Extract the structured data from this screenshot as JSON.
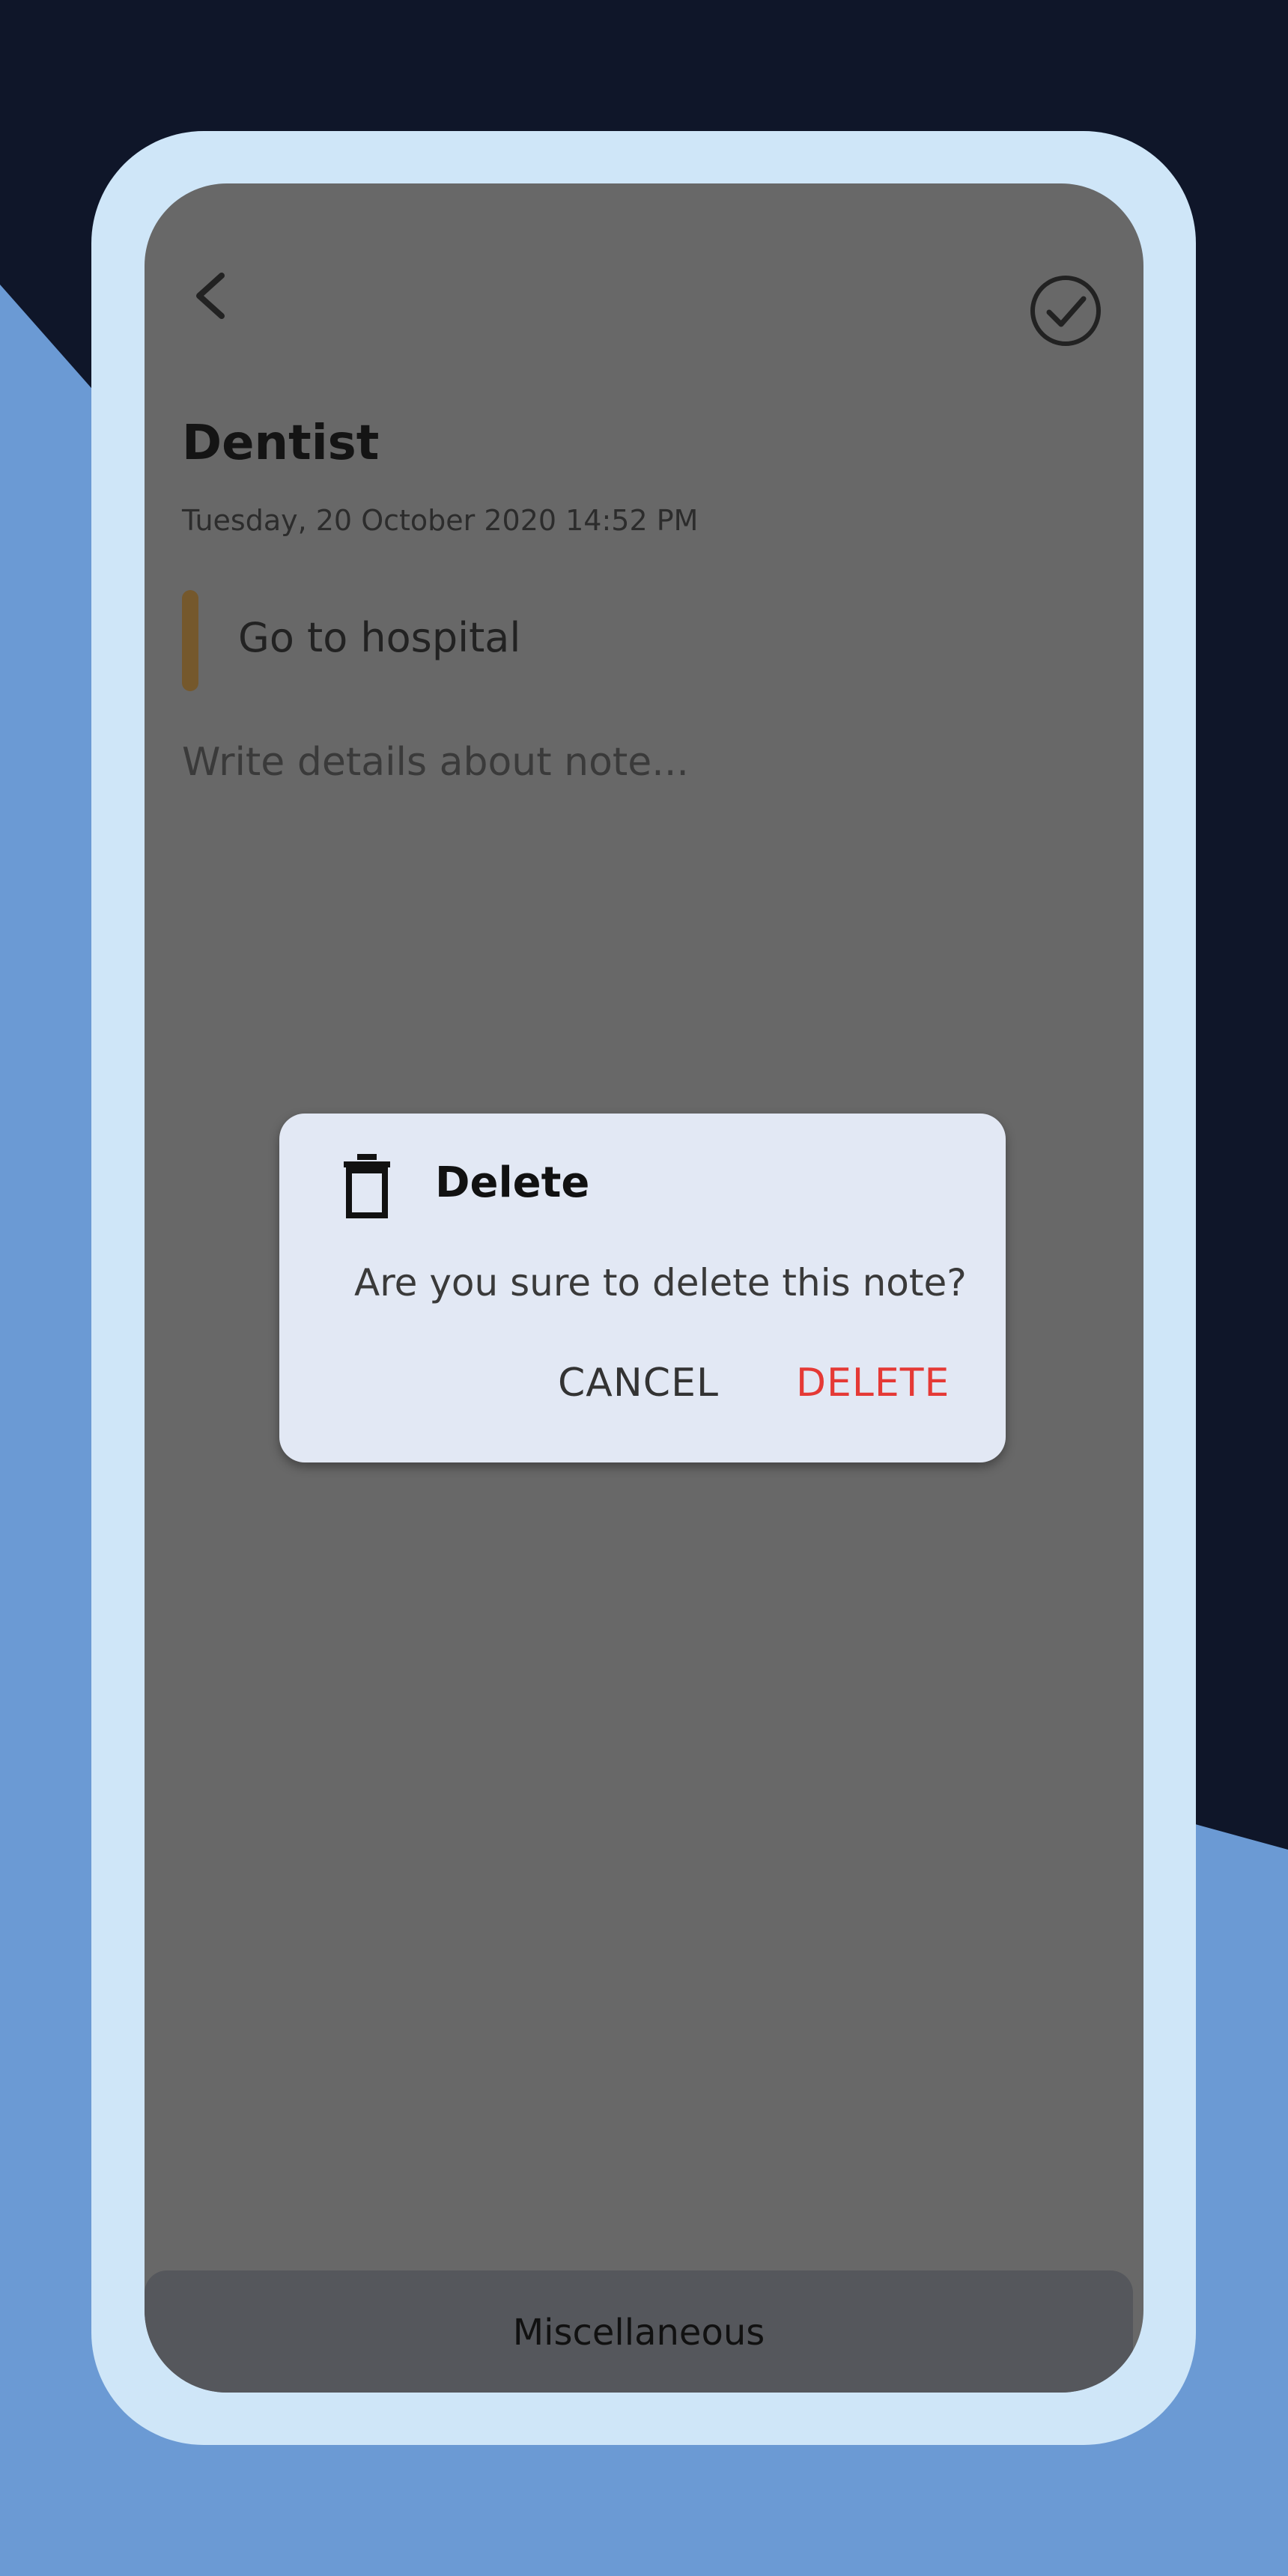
{
  "note": {
    "title": "Dentist",
    "date": "Tuesday, 20 October 2020 14:52 PM",
    "subtitle": "Go to hospital",
    "details_placeholder": "Write details about note..."
  },
  "dialog": {
    "title": "Delete",
    "message": "Are you sure to delete this note?",
    "cancel_label": "CANCEL",
    "delete_label": "DELETE"
  },
  "category": {
    "label": "Miscellaneous"
  },
  "icons": {
    "back": "chevron-left-icon",
    "done": "check-circle-icon",
    "trash": "trash-icon"
  },
  "colors": {
    "background_dark": "#0f1629",
    "background_accent": "#6b9ad4",
    "phone_frame": "#cfe6f8",
    "screen_dim": "#686868",
    "subtitle_indicator": "#75582c",
    "delete_red": "#e53935",
    "dialog_bg": "#e2e8f4"
  }
}
